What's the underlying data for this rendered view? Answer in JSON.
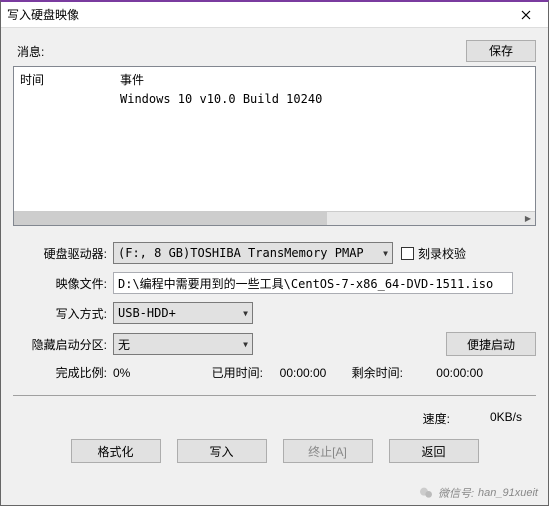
{
  "title": "写入硬盘映像",
  "msg_label": "消息:",
  "save_btn": "保存",
  "msg_table": {
    "col_time": "时间",
    "col_event": "事件",
    "event_text": "Windows 10 v10.0 Build 10240"
  },
  "form": {
    "drive_label": "硬盘驱动器:",
    "drive_value": "(F:, 8 GB)TOSHIBA TransMemory    PMAP",
    "verify_label": "刻录校验",
    "image_label": "映像文件:",
    "image_value": "D:\\编程中需要用到的一些工具\\CentOS-7-x86_64-DVD-1511.iso",
    "method_label": "写入方式:",
    "method_value": "USB-HDD+",
    "partition_label": "隐藏启动分区:",
    "partition_value": "无",
    "portable_btn": "便捷启动",
    "progress_label": "完成比例:",
    "progress_value": "0%",
    "elapsed_label": "已用时间:",
    "elapsed_value": "00:00:00",
    "remain_label": "剩余时间:",
    "remain_value": "00:00:00"
  },
  "speed": {
    "label": "速度:",
    "value": "0KB/s"
  },
  "buttons": {
    "format": "格式化",
    "write": "写入",
    "abort": "终止[A]",
    "back": "返回"
  },
  "footer": {
    "prefix": "微信号:",
    "id": "han_91xueit"
  }
}
